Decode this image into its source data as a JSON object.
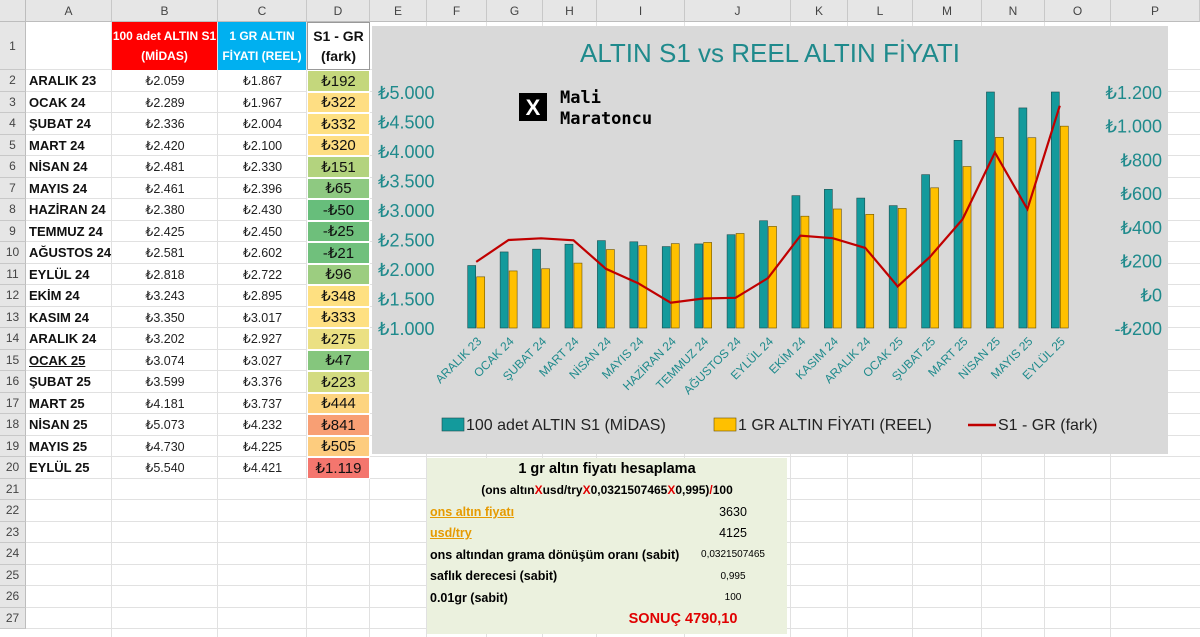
{
  "columns": [
    "A",
    "B",
    "C",
    "D",
    "E",
    "F",
    "G",
    "H",
    "I",
    "J",
    "K",
    "L",
    "M",
    "N",
    "O",
    "P"
  ],
  "rows": [
    "1",
    "2",
    "3",
    "4",
    "5",
    "6",
    "7",
    "8",
    "9",
    "10",
    "11",
    "12",
    "13",
    "14",
    "15",
    "16",
    "17",
    "18",
    "19",
    "20",
    "21",
    "22",
    "23",
    "24",
    "25",
    "26",
    "27"
  ],
  "headers": {
    "b": "100 adet ALTIN S1 (MİDAS)",
    "c": "1 GR ALTIN FİYATI (REEL)",
    "d": "S1 - GR (fark)"
  },
  "table": [
    {
      "month": "ARALIK 23",
      "s1": "₺2.059",
      "gr": "₺1.867",
      "diff": "₺192",
      "color": "#c4d77c"
    },
    {
      "month": "OCAK 24",
      "s1": "₺2.289",
      "gr": "₺1.967",
      "diff": "₺322",
      "color": "#fede83"
    },
    {
      "month": "ŞUBAT 24",
      "s1": "₺2.336",
      "gr": "₺2.004",
      "diff": "₺332",
      "color": "#fee082"
    },
    {
      "month": "MART 24",
      "s1": "₺2.420",
      "gr": "₺2.100",
      "diff": "₺320",
      "color": "#fede83"
    },
    {
      "month": "NİSAN 24",
      "s1": "₺2.481",
      "gr": "₺2.330",
      "diff": "₺151",
      "color": "#b3d37e"
    },
    {
      "month": "MAYIS 24",
      "s1": "₺2.461",
      "gr": "₺2.396",
      "diff": "₺65",
      "color": "#8ec981"
    },
    {
      "month": "HAZİRAN 24",
      "s1": "₺2.380",
      "gr": "₺2.430",
      "diff": "-₺50",
      "color": "#67be7b"
    },
    {
      "month": "TEMMUZ 24",
      "s1": "₺2.425",
      "gr": "₺2.450",
      "diff": "-₺25",
      "color": "#6ebf7b"
    },
    {
      "month": "AĞUSTOS 24",
      "s1": "₺2.581",
      "gr": "₺2.602",
      "diff": "-₺21",
      "color": "#70c07c"
    },
    {
      "month": "EYLÜL 24",
      "s1": "₺2.818",
      "gr": "₺2.722",
      "diff": "₺96",
      "color": "#9ccd80"
    },
    {
      "month": "EKİM 24",
      "s1": "₺3.243",
      "gr": "₺2.895",
      "diff": "₺348",
      "color": "#fee081"
    },
    {
      "month": "KASIM 24",
      "s1": "₺3.350",
      "gr": "₺3.017",
      "diff": "₺333",
      "color": "#fee082"
    },
    {
      "month": "ARALIK 24",
      "s1": "₺3.202",
      "gr": "₺2.927",
      "diff": "₺275",
      "color": "#ebe083"
    },
    {
      "month": "OCAK 25",
      "s1": "₺3.074",
      "gr": "₺3.027",
      "diff": "₺47",
      "color": "#85c67d"
    },
    {
      "month": "ŞUBAT 25",
      "s1": "₺3.599",
      "gr": "₺3.376",
      "diff": "₺223",
      "color": "#d3db81"
    },
    {
      "month": "MART 25",
      "s1": "₺4.181",
      "gr": "₺3.737",
      "diff": "₺444",
      "color": "#fdd47f"
    },
    {
      "month": "NİSAN 25",
      "s1": "₺5.073",
      "gr": "₺4.232",
      "diff": "₺841",
      "color": "#f89f74"
    },
    {
      "month": "MAYIS 25",
      "s1": "₺4.730",
      "gr": "₺4.225",
      "diff": "₺505",
      "color": "#fdcc7e"
    },
    {
      "month": "EYLÜL 25",
      "s1": "₺5.540",
      "gr": "₺4.421",
      "diff": "₺1.119",
      "color": "#f4766e"
    }
  ],
  "chart": {
    "title": "ALTIN S1 vs REEL ALTIN FİYATI",
    "watermark_line1": "Mali",
    "watermark_line2": "Maratoncu",
    "watermark_icon": "x-logo-icon",
    "left_ticks": [
      "₺5.000",
      "₺4.500",
      "₺4.000",
      "₺3.500",
      "₺3.000",
      "₺2.500",
      "₺2.000",
      "₺1.500",
      "₺1.000"
    ],
    "right_ticks": [
      "₺1.200",
      "₺1.000",
      "₺800",
      "₺600",
      "₺400",
      "₺200",
      "₺0",
      "-₺200"
    ]
  },
  "chart_data": {
    "type": "bar",
    "title": "ALTIN S1 vs REEL ALTIN FİYATI",
    "categories": [
      "ARALIK 23",
      "OCAK 24",
      "ŞUBAT 24",
      "MART 24",
      "NİSAN 24",
      "MAYIS 24",
      "HAZİRAN 24",
      "TEMMUZ 24",
      "AĞUSTOS 24",
      "EYLÜL 24",
      "EKİM 24",
      "KASIM 24",
      "ARALIK 24",
      "OCAK 25",
      "ŞUBAT 25",
      "MART 25",
      "NİSAN 25",
      "MAYIS 25",
      "EYLÜL 25"
    ],
    "series": [
      {
        "name": "100 adet ALTIN S1 (MİDAS)",
        "type": "bar",
        "axis": "left",
        "color": "#139a9c",
        "values": [
          2059,
          2289,
          2336,
          2420,
          2481,
          2461,
          2380,
          2425,
          2581,
          2818,
          3243,
          3350,
          3202,
          3074,
          3599,
          4181,
          5073,
          4730,
          5540
        ]
      },
      {
        "name": "1 GR ALTIN FİYATI (REEL)",
        "type": "bar",
        "axis": "left",
        "color": "#ffc000",
        "values": [
          1867,
          1967,
          2004,
          2100,
          2330,
          2396,
          2430,
          2450,
          2602,
          2722,
          2895,
          3017,
          2927,
          3027,
          3376,
          3737,
          4232,
          4225,
          4421
        ]
      },
      {
        "name": "S1 - GR (fark)",
        "type": "line",
        "axis": "right",
        "color": "#c00000",
        "values": [
          192,
          322,
          332,
          320,
          151,
          65,
          -50,
          -25,
          -21,
          96,
          348,
          333,
          275,
          47,
          223,
          444,
          841,
          505,
          1119
        ]
      }
    ],
    "ylim_left": [
      1000,
      5000
    ],
    "ylim_right": [
      -200,
      1200
    ],
    "legend_position": "bottom",
    "grid": false
  },
  "calc": {
    "title": "1 gr altın fiyatı hesaplama",
    "formula_prefix": "(ons altın ",
    "formula_x1": "X",
    "formula_mid1": " usd/try ",
    "formula_x2": "X",
    "formula_mid2": " 0,0321507465 ",
    "formula_x3": "X",
    "formula_mid3": " 0,995) ",
    "formula_div": "/",
    "formula_end": " 100",
    "ons_label": "ons altın fiyatı",
    "ons_value": "3630",
    "usd_label": "usd/try",
    "usd_value": "4125",
    "rate_label": "ons altından grama dönüşüm oranı (sabit)",
    "rate_value": "0,0321507465",
    "purity_label": "saflık derecesi (sabit)",
    "purity_value": "0,995",
    "gr_label": "0.01gr (sabit)",
    "gr_value": "100",
    "result_label": "SONUÇ",
    "result_value": "4790,10"
  }
}
